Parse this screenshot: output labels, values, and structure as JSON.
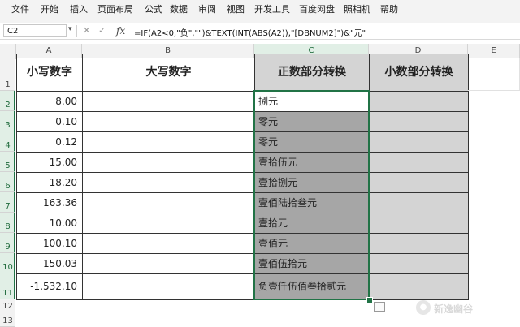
{
  "menu": [
    "文件",
    "开始",
    "插入",
    "页面布局",
    "公式",
    "数据",
    "审阅",
    "视图",
    "开发工具",
    "百度网盘",
    "照相机",
    "帮助"
  ],
  "formula_bar": {
    "name_box": "C2",
    "fx": "fx",
    "formula": "=IF(A2<0,\"负\",\"\")&TEXT(INT(ABS(A2)),\"[DBNUM2]\")&\"元\""
  },
  "columns": [
    "A",
    "B",
    "C",
    "D",
    "E"
  ],
  "rows": [
    "1",
    "2",
    "3",
    "4",
    "5",
    "6",
    "7",
    "8",
    "9",
    "10",
    "11",
    "12",
    "13"
  ],
  "headers": {
    "a": "小写数字",
    "b": "大写数字",
    "c": "正数部分转换",
    "d": "小数部分转换"
  },
  "data": [
    {
      "a": "8.00",
      "b": "",
      "c": "捌元",
      "d": ""
    },
    {
      "a": "0.10",
      "b": "",
      "c": "零元",
      "d": ""
    },
    {
      "a": "0.12",
      "b": "",
      "c": "零元",
      "d": ""
    },
    {
      "a": "15.00",
      "b": "",
      "c": "壹拾伍元",
      "d": ""
    },
    {
      "a": "18.20",
      "b": "",
      "c": "壹拾捌元",
      "d": ""
    },
    {
      "a": "163.36",
      "b": "",
      "c": "壹佰陆拾叁元",
      "d": ""
    },
    {
      "a": "10.00",
      "b": "",
      "c": "壹拾元",
      "d": ""
    },
    {
      "a": "100.10",
      "b": "",
      "c": "壹佰元",
      "d": ""
    },
    {
      "a": "150.03",
      "b": "",
      "c": "壹佰伍拾元",
      "d": ""
    },
    {
      "a": "-1,532.10",
      "b": "",
      "c": "负壹仟伍佰叁拾贰元",
      "d": ""
    }
  ],
  "watermark": "新逸幽谷",
  "colors": {
    "selection": "#217346",
    "fill_dark": "#a6a6a6",
    "fill_mid": "#d4d4d4"
  }
}
